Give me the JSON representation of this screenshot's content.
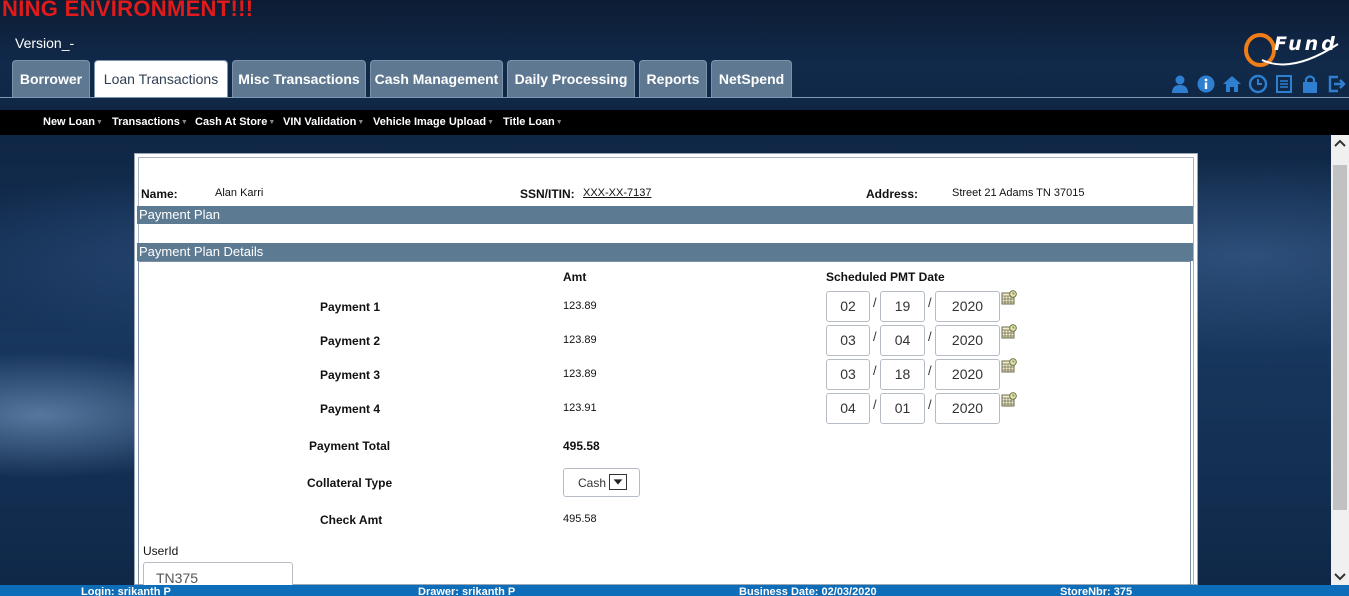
{
  "header": {
    "env_banner": "NING ENVIRONMENT!!!",
    "version": "Version_-",
    "logo_text": "Fund",
    "tabs": [
      {
        "label": "Borrower"
      },
      {
        "label": "Loan Transactions"
      },
      {
        "label": "Misc Transactions"
      },
      {
        "label": "Cash Management"
      },
      {
        "label": "Daily Processing"
      },
      {
        "label": "Reports"
      },
      {
        "label": "NetSpend"
      }
    ],
    "active_tab": "Loan Transactions",
    "icons": [
      "user-icon",
      "info-icon",
      "home-icon",
      "clock-icon",
      "notes-icon",
      "lock-icon",
      "logout-icon"
    ],
    "icon_color": "#2f7fd0"
  },
  "submenu": {
    "items": [
      {
        "label": "New Loan"
      },
      {
        "label": "Transactions"
      },
      {
        "label": "Cash At Store"
      },
      {
        "label": "VIN Validation"
      },
      {
        "label": "Vehicle Image Upload"
      },
      {
        "label": "Title Loan"
      }
    ]
  },
  "customer": {
    "name_label": "Name:",
    "name": "Alan Karri",
    "ssn_label": "SSN/ITIN:",
    "ssn": "XXX-XX-7137",
    "address_label": "Address:",
    "address": "Street 21  Adams  TN  37015"
  },
  "sections": {
    "payment_plan": "Payment Plan",
    "payment_plan_details": "Payment Plan Details"
  },
  "plan": {
    "amt_header": "Amt",
    "date_header": "Scheduled PMT Date",
    "payments": [
      {
        "label": "Payment 1",
        "amt": "123.89",
        "mm": "02",
        "dd": "19",
        "yyyy": "2020"
      },
      {
        "label": "Payment 2",
        "amt": "123.89",
        "mm": "03",
        "dd": "04",
        "yyyy": "2020"
      },
      {
        "label": "Payment 3",
        "amt": "123.89",
        "mm": "03",
        "dd": "18",
        "yyyy": "2020"
      },
      {
        "label": "Payment 4",
        "amt": "123.91",
        "mm": "04",
        "dd": "01",
        "yyyy": "2020"
      }
    ],
    "date_separator": "/",
    "total_label": "Payment Total",
    "total_value": "495.58",
    "collateral_label": "Collateral Type",
    "collateral_value": "Cash",
    "check_amt_label": "Check Amt",
    "check_amt_value": "495.58",
    "userid_label": "UserId",
    "userid_value": "TN375"
  },
  "footer": {
    "login": "Login: srikanth P",
    "drawer": "Drawer: srikanth P",
    "business_date": "Business Date: 02/03/2020",
    "store": "StoreNbr: 375"
  },
  "colors": {
    "env_banner": "#e01b1b",
    "tab_bg": "#5f7892",
    "section_bar": "#5d7a93",
    "footer_bg": "#0e6db8"
  }
}
